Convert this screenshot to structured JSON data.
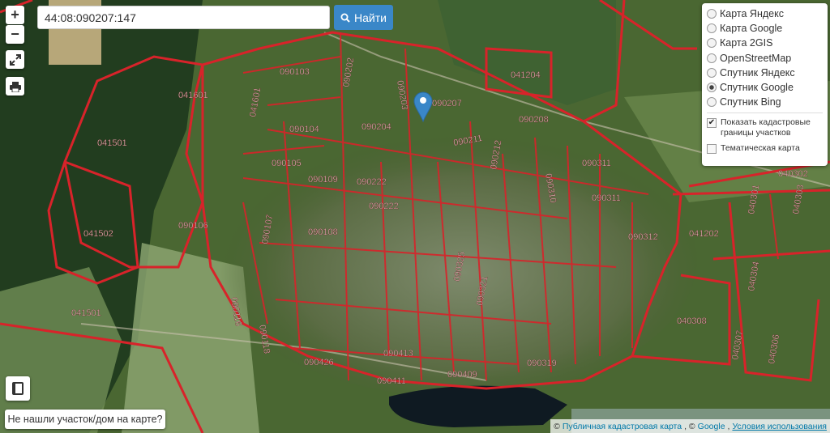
{
  "search": {
    "value": "44:08:090207:147",
    "button_label": "Найти"
  },
  "controls": {
    "zoom_in": "+",
    "zoom_out": "−"
  },
  "layers": {
    "options": [
      {
        "label": "Карта Яндекс",
        "selected": false
      },
      {
        "label": "Карта Google",
        "selected": false
      },
      {
        "label": "Карта 2GIS",
        "selected": false
      },
      {
        "label": "OpenStreetMap",
        "selected": false
      },
      {
        "label": "Спутник Яндекс",
        "selected": false
      },
      {
        "label": "Спутник Google",
        "selected": true
      },
      {
        "label": "Спутник Bing",
        "selected": false
      }
    ],
    "show_cadastral": {
      "label": "Показать кадастровые границы участков",
      "checked": true
    },
    "thematic": {
      "label": "Тематическая карта",
      "checked": false
    }
  },
  "not_found_label": "Не нашли участок/дом на карте?",
  "attribution": {
    "copyright": "©",
    "link1": "Публичная кадастровая карта",
    "sep": ", ©",
    "link2": "Google",
    "sep2": ",",
    "link3": "Условия использования"
  },
  "map_labels": [
    "090103",
    "090202",
    "090203",
    "090207",
    "041204",
    "041601",
    "041601",
    "090104",
    "090204",
    "090208",
    "041501",
    "090105",
    "090211",
    "090212",
    "090310",
    "090311",
    "090311",
    "040302",
    "090109",
    "090222",
    "090222",
    "090106",
    "041502",
    "090107",
    "090108",
    "090312",
    "041202",
    "040301",
    "040303",
    "090116",
    "090118",
    "041501",
    "090325",
    "090321",
    "040304",
    "040308",
    "040307",
    "040306",
    "090426",
    "090413",
    "090411",
    "090409",
    "090319"
  ],
  "colors": {
    "boundary": "#d8232a",
    "label": "#f2d0d0",
    "marker": "#3a87c8",
    "accent": "#3a87c8"
  }
}
